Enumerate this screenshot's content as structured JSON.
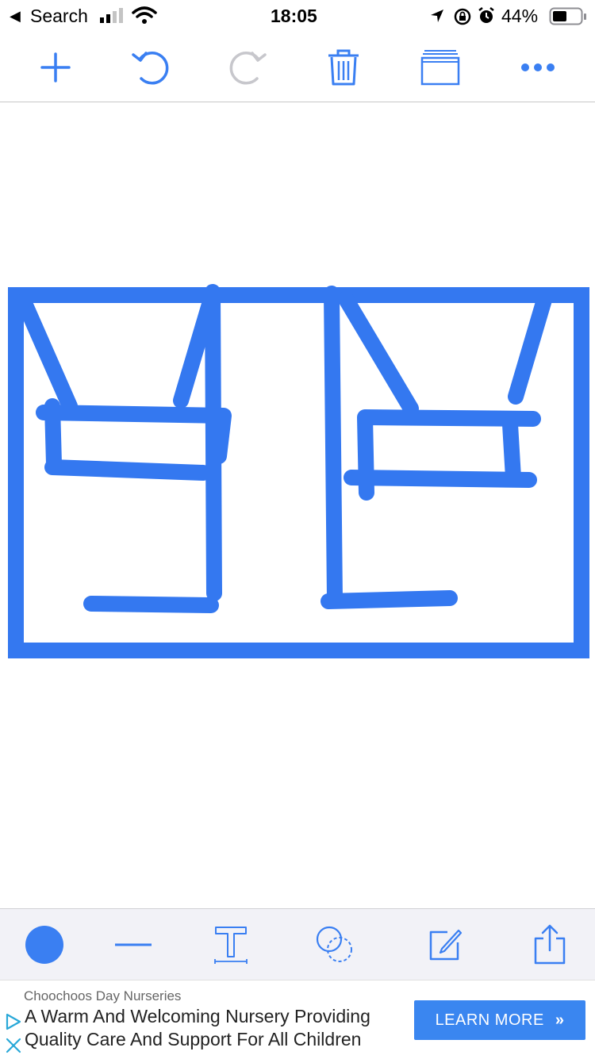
{
  "status_bar": {
    "back_label": "Search",
    "time": "18:05",
    "battery": "44%"
  },
  "toolbar": {
    "icons": [
      "plus-icon",
      "undo-icon",
      "redo-icon",
      "trash-icon",
      "pages-icon",
      "more-icon"
    ]
  },
  "bottom_toolbar": {
    "icons": [
      "color-dot-icon",
      "line-width-icon",
      "text-tool-icon",
      "shapes-icon",
      "edit-icon",
      "share-icon"
    ]
  },
  "colors": {
    "accent": "#3a7ff2",
    "stroke": "#3478f0",
    "disabled": "#c7c7cc"
  },
  "ad": {
    "sponsor": "Choochoos Day Nurseries",
    "line1": "A Warm And Welcoming Nursery Providing",
    "line2": "Quality Care And Support For All Children",
    "cta": "LEARN MORE",
    "cta_chevron": "»"
  }
}
